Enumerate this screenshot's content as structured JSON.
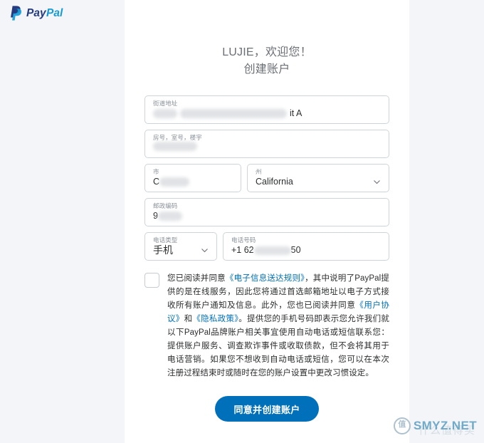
{
  "brand": {
    "logo_text": "PayPal",
    "logo_icon": "paypal-p-mark",
    "colors": {
      "dark_blue": "#253b80",
      "light_blue": "#179bd7",
      "accent": "#0070ba",
      "page_bg": "#f4f5f9",
      "card_bg": "#ffffff"
    }
  },
  "headings": {
    "welcome": "LUJIE，欢迎您！",
    "subtitle": "创建账户"
  },
  "form": {
    "street": {
      "label": "街道地址",
      "value_visible_suffix": "it A",
      "redacted": true
    },
    "unit": {
      "label": "房号，室号，楼宇",
      "value_visible_suffix": "",
      "redacted": true
    },
    "city": {
      "label": "市",
      "value_visible_prefix": "C",
      "redacted": true
    },
    "state": {
      "label": "州",
      "value": "California",
      "icon": "chevron-down-icon"
    },
    "postal": {
      "label": "邮政编码",
      "value_visible_prefix": "9",
      "redacted": true
    },
    "phone_type": {
      "label": "电话类型",
      "value": "手机",
      "icon": "chevron-down-icon"
    },
    "phone_number": {
      "label": "电话号码",
      "value_prefix": "+1  62",
      "value_suffix": "50",
      "redacted": true
    }
  },
  "consent": {
    "checked": false,
    "parts": [
      {
        "type": "text",
        "text": "您已阅读并同意"
      },
      {
        "type": "link",
        "text": "《电子信息送达规则》"
      },
      {
        "type": "text",
        "text": "，其中说明了PayPal提供的是在线服务，因此您将通过首选邮箱地址以电子方式接收所有账户通知及信息。此外，您也已阅读并同意"
      },
      {
        "type": "link",
        "text": "《用户协议》"
      },
      {
        "type": "text",
        "text": "和"
      },
      {
        "type": "link",
        "text": "《隐私政策》"
      },
      {
        "type": "text",
        "text": "。提供您的手机号码即表示您允许我们就以下PayPal品牌账户相关事宜使用自动电话或短信联系您：提供账户服务、调查欺诈事件或收取债款，但不会将其用于电话营销。如果您不想收到自动电话或短信，您可以在本次注册过程结束时或随时在您的账户设置中更改习惯设定。"
      }
    ]
  },
  "submit": {
    "label": "同意并创建账户"
  },
  "watermark": {
    "badge": "值",
    "text": "SMYZ.NET",
    "ghost": "什么值得买"
  }
}
